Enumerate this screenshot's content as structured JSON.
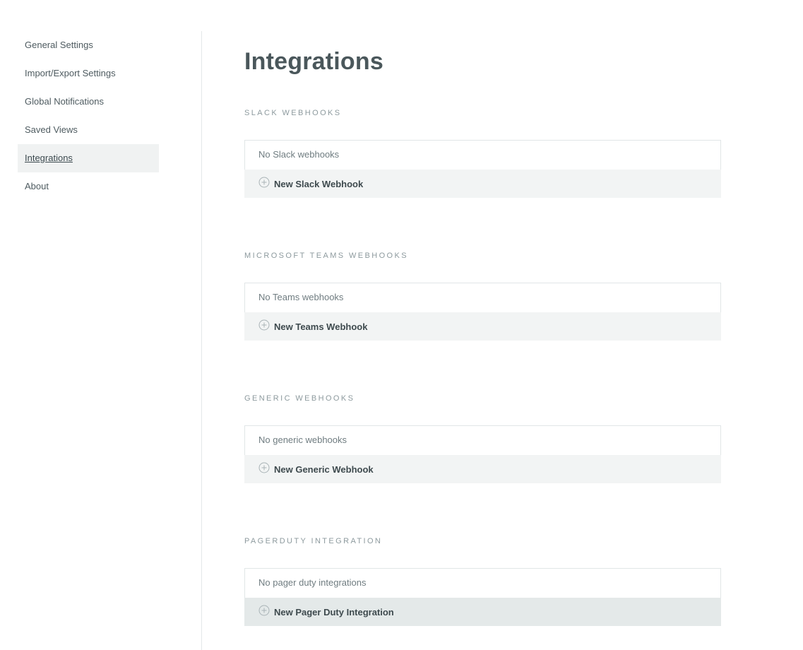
{
  "sidebar": {
    "items": [
      {
        "label": "General Settings"
      },
      {
        "label": "Import/Export Settings"
      },
      {
        "label": "Global Notifications"
      },
      {
        "label": "Saved Views"
      },
      {
        "label": "Integrations",
        "active": true
      },
      {
        "label": "About"
      }
    ]
  },
  "main": {
    "title": "Integrations",
    "sections": [
      {
        "heading": "SLACK WEBHOOKS",
        "empty_text": "No Slack webhooks",
        "add_label": "New Slack Webhook"
      },
      {
        "heading": "MICROSOFT TEAMS WEBHOOKS",
        "empty_text": "No Teams webhooks",
        "add_label": "New Teams Webhook"
      },
      {
        "heading": "GENERIC WEBHOOKS",
        "empty_text": "No generic webhooks",
        "add_label": "New Generic Webhook"
      },
      {
        "heading": "PAGERDUTY INTEGRATION",
        "empty_text": "No pager duty integrations",
        "add_label": "New Pager Duty Integration"
      }
    ]
  },
  "icons": {
    "add": "plus-circle-icon"
  },
  "colors": {
    "sidebar_active_bg": "#f0f2f2",
    "add_row_bg": "#f2f4f4",
    "add_row_hover_bg": "#e4e9e9",
    "heading": "#8d9a9e",
    "title": "#4a575b"
  }
}
